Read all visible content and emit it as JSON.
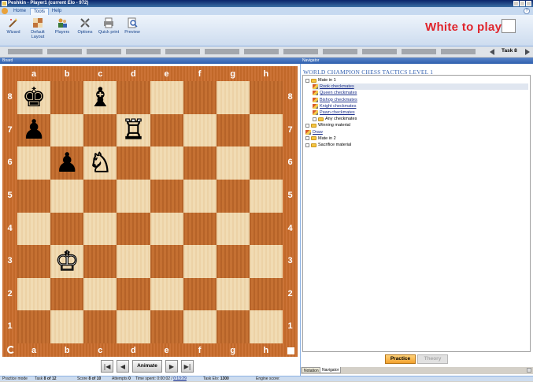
{
  "window": {
    "title": "Peshkin - Player1 (current Elo - 972)"
  },
  "ribbon": {
    "tabs": [
      "Home",
      "Tools",
      "Help"
    ],
    "active_tab": "Tools",
    "buttons": [
      {
        "label": "Wizard",
        "icon": "wizard-icon"
      },
      {
        "label": "Default Layout",
        "icon": "layout-icon"
      },
      {
        "label": "Players",
        "icon": "players-icon"
      },
      {
        "label": "Options",
        "icon": "options-icon"
      },
      {
        "label": "Quick print",
        "icon": "print-icon"
      },
      {
        "label": "Preview",
        "icon": "preview-icon"
      }
    ],
    "turn_text": "White to play"
  },
  "task_strip": {
    "label": "Task 8"
  },
  "board_panel": {
    "title": "Board",
    "files": [
      "a",
      "b",
      "c",
      "d",
      "e",
      "f",
      "g",
      "h"
    ],
    "ranks": [
      "8",
      "7",
      "6",
      "5",
      "4",
      "3",
      "2",
      "1"
    ],
    "pieces": [
      {
        "square": "a8",
        "glyph": "♚",
        "color": "black"
      },
      {
        "square": "c8",
        "glyph": "♝",
        "color": "black"
      },
      {
        "square": "a7",
        "glyph": "♟",
        "color": "black"
      },
      {
        "square": "d7",
        "glyph": "♖",
        "color": "white"
      },
      {
        "square": "b6",
        "glyph": "♟",
        "color": "black"
      },
      {
        "square": "c6",
        "glyph": "♘",
        "color": "white"
      },
      {
        "square": "b3",
        "glyph": "♔",
        "color": "white"
      }
    ],
    "nav": {
      "first": "|◀",
      "prev": "◀",
      "animate": "Animate",
      "next": "▶",
      "last": "▶|"
    }
  },
  "navigator": {
    "title": "Navigator",
    "heading": "WORLD CHAMPION CHESS TACTICS LEVEL 1",
    "tree": [
      {
        "label": "Mate in 1",
        "type": "folder",
        "expander": "⊟",
        "indent": 0,
        "link": false
      },
      {
        "label": "Rook checkmates",
        "type": "task",
        "indent": 1,
        "link": true,
        "selected": true
      },
      {
        "label": "Queen checkmates",
        "type": "task",
        "indent": 1,
        "link": true
      },
      {
        "label": "Bishop checkmates",
        "type": "task",
        "indent": 1,
        "link": true
      },
      {
        "label": "Knight checkmates",
        "type": "task",
        "indent": 1,
        "link": true
      },
      {
        "label": "Pawn checkmates",
        "type": "task",
        "indent": 1,
        "link": true
      },
      {
        "label": "Any checkmates",
        "type": "folder",
        "expander": "⊞",
        "indent": 1,
        "link": false
      },
      {
        "label": "Winning material",
        "type": "folder",
        "expander": "⊞",
        "indent": 0,
        "link": false
      },
      {
        "label": "Draw",
        "type": "task",
        "indent": 0,
        "link": true
      },
      {
        "label": "Mate in 2",
        "type": "folder",
        "expander": "⊞",
        "indent": 0,
        "link": false
      },
      {
        "label": "Sacrifice material",
        "type": "folder",
        "expander": "⊞",
        "indent": 0,
        "link": false
      }
    ],
    "practice_label": "Practice",
    "theory_label": "Theory",
    "tabs": [
      "Notation",
      "Navigator"
    ],
    "active_tab": "Navigator"
  },
  "status": {
    "mode": "Practice mode",
    "task_prefix": "Task ",
    "task_value": "8 of 12",
    "score_prefix": "Score ",
    "score_value": "8 of 10",
    "attempts_prefix": "Attempts ",
    "attempts_value": "0",
    "time_prefix": "Time spent: ",
    "time_value": "0:00:02 / ",
    "time_link": "0:13:29",
    "elo_prefix": "Task Elo: ",
    "elo_value": "1300",
    "engine": "Engine score:"
  },
  "colors": {
    "turn_text": "#e0242b",
    "board_dark": "#c16a2c",
    "board_light": "#f0d9ae"
  }
}
